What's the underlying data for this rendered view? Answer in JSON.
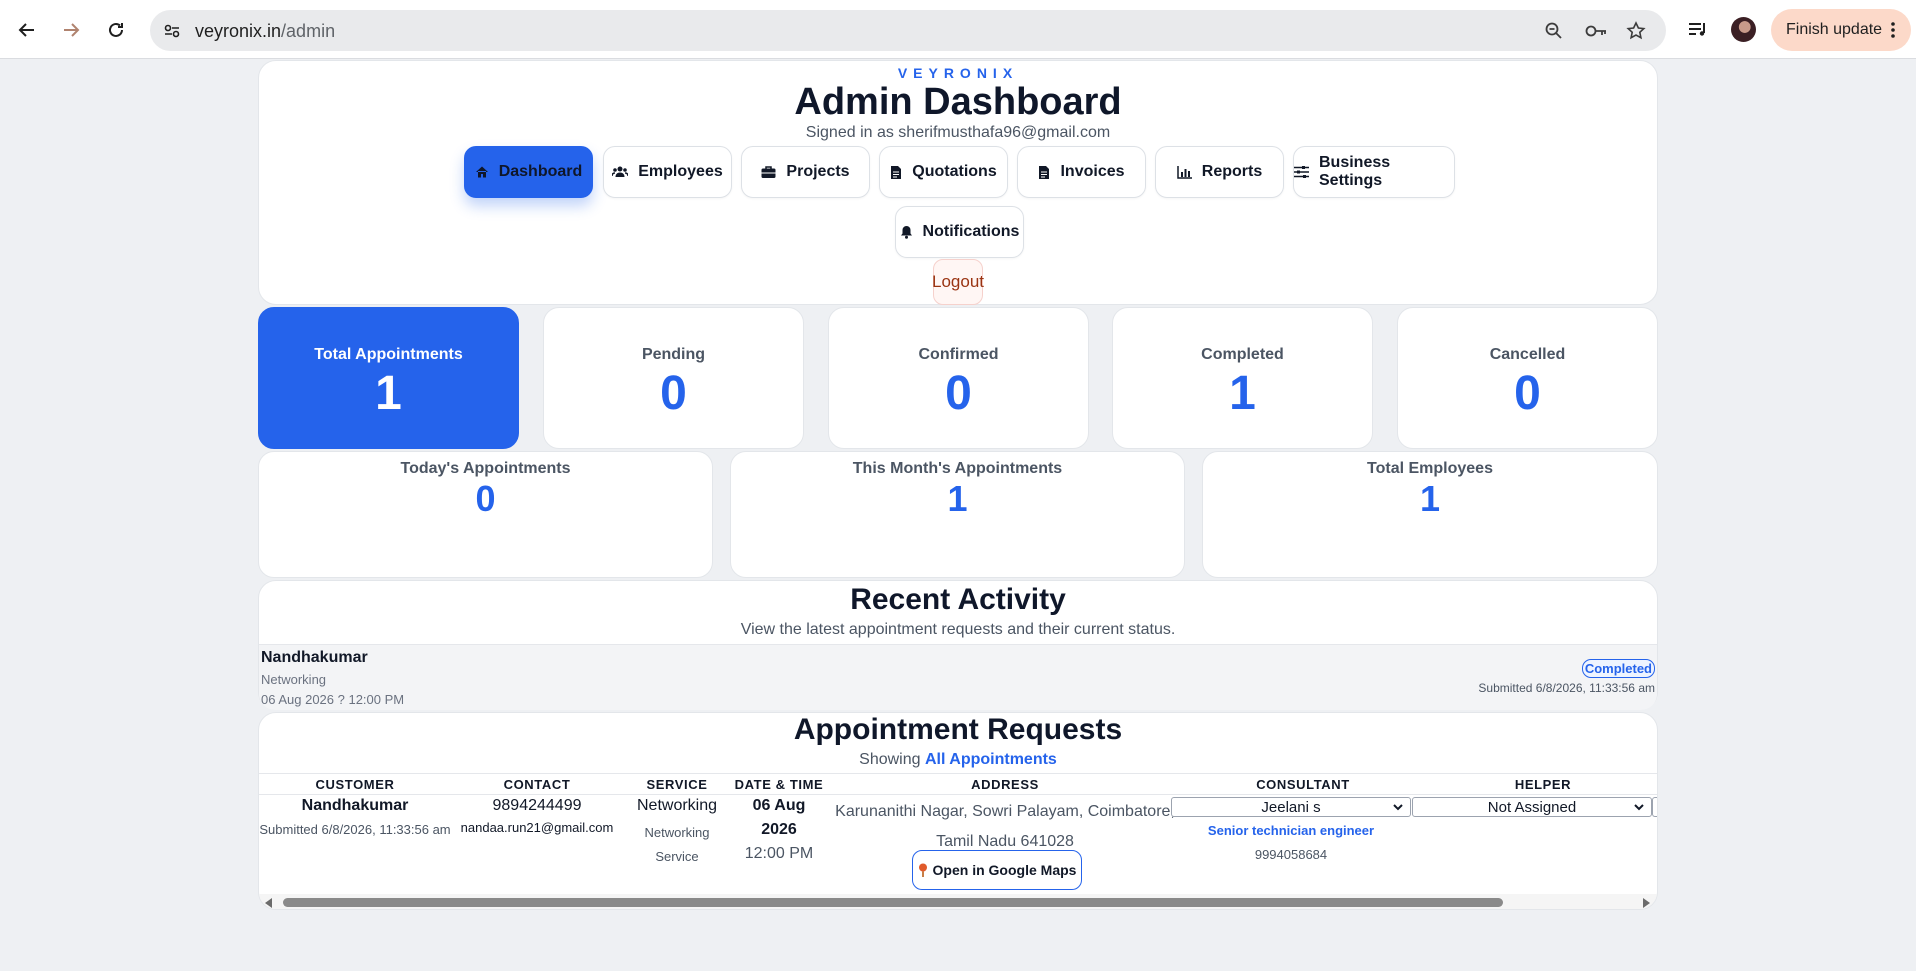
{
  "browser": {
    "url_domain": "veyronix.in",
    "url_path": "/admin",
    "finish_update_label": "Finish update"
  },
  "header": {
    "brand": "VEYRONIX",
    "title": "Admin Dashboard",
    "signed_in": "Signed in as sherifmusthafa96@gmail.com",
    "nav": [
      {
        "label": "Dashboard",
        "icon": "home-icon",
        "active": true
      },
      {
        "label": "Employees",
        "icon": "users-icon"
      },
      {
        "label": "Projects",
        "icon": "briefcase-icon"
      },
      {
        "label": "Quotations",
        "icon": "document-icon"
      },
      {
        "label": "Invoices",
        "icon": "document-icon"
      },
      {
        "label": "Reports",
        "icon": "bar-chart-icon"
      },
      {
        "label": "Business Settings",
        "icon": "sliders-icon"
      },
      {
        "label": "Notifications",
        "icon": "bell-icon"
      }
    ],
    "logout_label": "Logout"
  },
  "stats": [
    {
      "label": "Total Appointments",
      "value": "1"
    },
    {
      "label": "Pending",
      "value": "0"
    },
    {
      "label": "Confirmed",
      "value": "0"
    },
    {
      "label": "Completed",
      "value": "1"
    },
    {
      "label": "Cancelled",
      "value": "0"
    }
  ],
  "stats2": [
    {
      "label": "Today's Appointments",
      "value": "0"
    },
    {
      "label": "This Month's Appointments",
      "value": "1"
    },
    {
      "label": "Total Employees",
      "value": "1"
    }
  ],
  "activity": {
    "title": "Recent Activity",
    "subtitle": "View the latest appointment requests and their current status.",
    "item": {
      "name": "Nandhakumar",
      "service": "Networking",
      "datetime": "06 Aug 2026 ? 12:00 PM",
      "status": "Completed",
      "submitted": "Submitted 6/8/2026, 11:33:56 am"
    }
  },
  "appointments": {
    "title": "Appointment Requests",
    "showing_prefix": "Showing",
    "showing_value": "All Appointments",
    "columns": [
      "CUSTOMER",
      "CONTACT",
      "SERVICE",
      "DATE & TIME",
      "ADDRESS",
      "CONSULTANT",
      "HELPER"
    ],
    "row": {
      "customer_name": "Nandhakumar",
      "customer_submitted": "Submitted 6/8/2026, 11:33:56 am",
      "phone": "9894244499",
      "email": "nandaa.run21@gmail.com",
      "service": "Networking",
      "service_sub": "Networking Service",
      "date_day": "06 Aug",
      "date_year": "2026",
      "time": "12:00 PM",
      "address": "Karunanithi Nagar, Sowri Palayam, Coimbatore, Tamil Nadu 641028",
      "maps_label": "Open in Google Maps",
      "consultant": "Jeelani s",
      "consultant_role": "Senior technician engineer",
      "consultant_phone": "9994058684",
      "helper": "Not Assigned"
    }
  },
  "colors": {
    "accent": "#2563eb",
    "background": "#eef0f3",
    "logout": "#9a3412"
  }
}
